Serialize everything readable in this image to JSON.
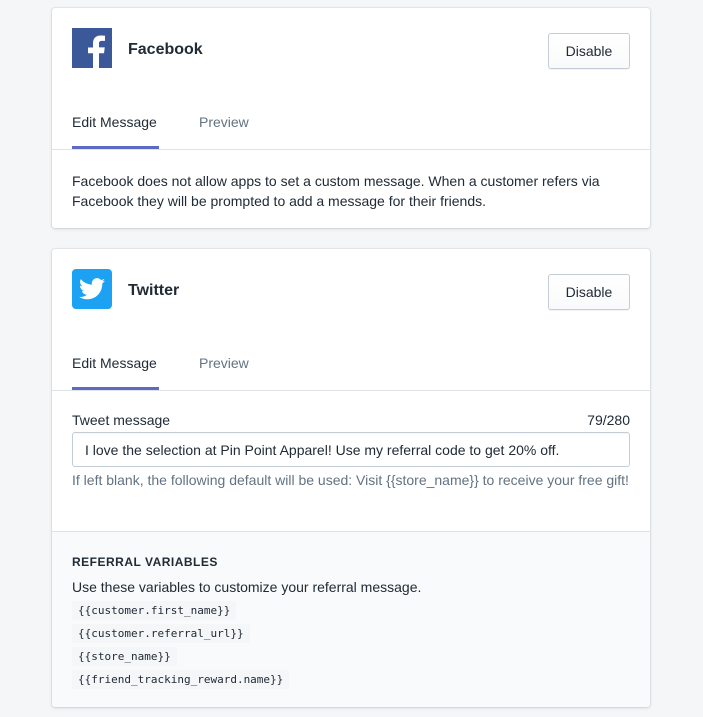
{
  "facebook": {
    "title": "Facebook",
    "disable_label": "Disable",
    "tabs": [
      {
        "label": "Edit Message",
        "active": true
      },
      {
        "label": "Preview",
        "active": false
      }
    ],
    "message": "Facebook does not allow apps to set a custom message. When a customer refers via Facebook they will be prompted to add a message for their friends.",
    "icon": "facebook-logo-icon"
  },
  "twitter": {
    "title": "Twitter",
    "disable_label": "Disable",
    "tabs": [
      {
        "label": "Edit Message",
        "active": true
      },
      {
        "label": "Preview",
        "active": false
      }
    ],
    "field_label": "Tweet message",
    "char_count": "79/280",
    "tweet_value": "I love the selection at Pin Point Apparel! Use my referral code to get 20% off.",
    "help_text": "If left blank, the following default will be used: Visit {{store_name}} to receive your free gift!",
    "icon": "twitter-logo-icon"
  },
  "referral_variables": {
    "heading": "REFERRAL VARIABLES",
    "description": "Use these variables to customize your referral message.",
    "items": [
      "{{customer.first_name}}",
      "{{customer.referral_url}}",
      "{{store_name}}",
      "{{friend_tracking_reward.name}}"
    ]
  },
  "colors": {
    "accent": "#5c6ac4",
    "facebook": "#3b5998",
    "twitter": "#1da1f2",
    "page_bg": "#f4f6f8"
  }
}
